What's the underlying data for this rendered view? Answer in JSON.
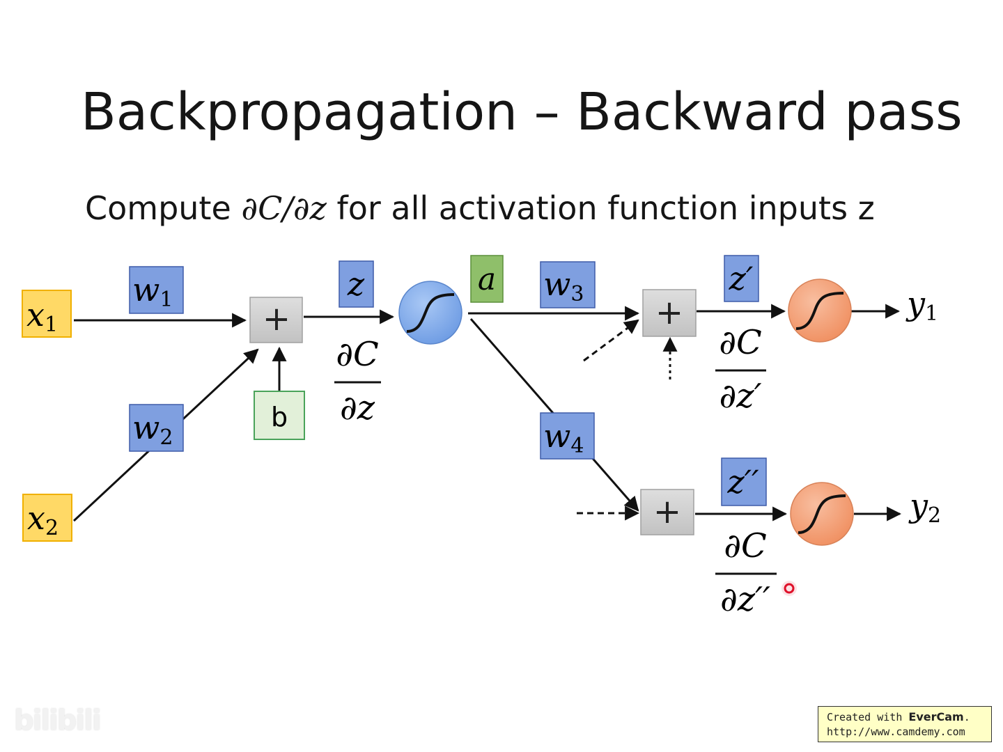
{
  "slide": {
    "title": "Backpropagation – Backward pass",
    "subtitle_prefix": "Compute ",
    "subtitle_math": "∂C/∂z",
    "subtitle_suffix": " for all activation function inputs z"
  },
  "diagram": {
    "inputs": [
      {
        "var": "x",
        "sub": "1"
      },
      {
        "var": "x",
        "sub": "2"
      }
    ],
    "weights": [
      {
        "var": "w",
        "sub": "1"
      },
      {
        "var": "w",
        "sub": "2"
      },
      {
        "var": "w",
        "sub": "3"
      },
      {
        "var": "w",
        "sub": "4"
      }
    ],
    "bias": "b",
    "sum_symbol": "+",
    "z_labels": [
      "z",
      "z′",
      "z′′"
    ],
    "activation_label": "a",
    "derivatives": [
      {
        "num": "∂C",
        "den": "∂z"
      },
      {
        "num": "∂C",
        "den": "∂z′"
      },
      {
        "num": "∂C",
        "den": "∂z′′"
      }
    ],
    "outputs": [
      {
        "var": "y",
        "sub": "1"
      },
      {
        "var": "y",
        "sub": "2"
      }
    ],
    "colors": {
      "input_fill": "#ffd966",
      "input_border": "#f0b000",
      "weight_fill": "#7f9fe0",
      "weight_border": "#3e5ba8",
      "bias_fill": "#e2f0d9",
      "bias_border": "#4aa35a",
      "activation_label_fill": "#8fbf6a",
      "activation_label_border": "#5a8f3a",
      "sum_fill": "#cfcfcf",
      "sum_border": "#a0a0a0",
      "sigmoid_blue": "#7eaeee",
      "sigmoid_orange": "#f4a47c",
      "cursor_marker": "#e0102a"
    },
    "icons": [
      "sigmoid-icon",
      "plus-icon"
    ]
  },
  "footer": {
    "watermark": "bilibili",
    "evercam_prefix": "Created with ",
    "evercam_brand": "EverCam",
    "evercam_suffix": ".",
    "evercam_url": "http://www.camdemy.com"
  }
}
